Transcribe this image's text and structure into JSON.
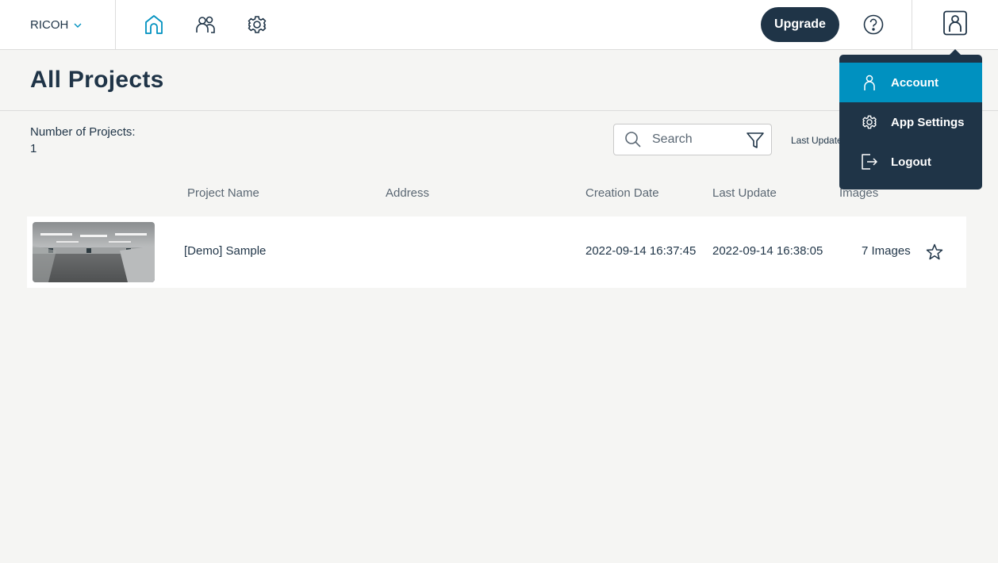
{
  "topbar": {
    "org_name": "RICOH",
    "upgrade_label": "Upgrade"
  },
  "page": {
    "title": "All Projects",
    "count_label": "Number of Projects:",
    "count_value": "1"
  },
  "search": {
    "placeholder": "Search"
  },
  "sort": {
    "label": "Last Update"
  },
  "table": {
    "headers": {
      "name": "Project Name",
      "address": "Address",
      "created": "Creation Date",
      "updated": "Last Update",
      "images": "Images"
    },
    "rows": [
      {
        "name": "[Demo] Sample",
        "address": "",
        "created": "2022-09-14 16:37:45",
        "updated": "2022-09-14 16:38:05",
        "images": "7 Images"
      }
    ]
  },
  "account_menu": {
    "items": [
      {
        "label": "Account",
        "icon": "user-icon",
        "active": true
      },
      {
        "label": "App Settings",
        "icon": "gear-icon",
        "active": false
      },
      {
        "label": "Logout",
        "icon": "logout-icon",
        "active": false
      }
    ]
  },
  "colors": {
    "navy": "#1f3447",
    "accent": "#0091c0",
    "background": "#f5f5f3"
  }
}
